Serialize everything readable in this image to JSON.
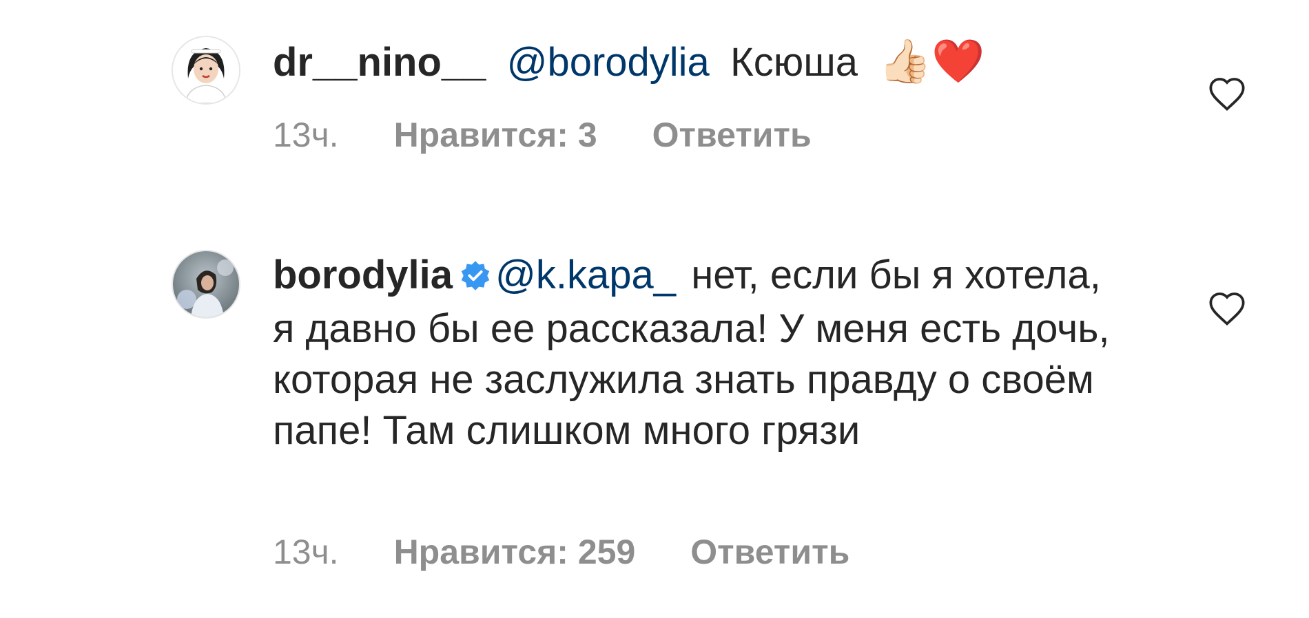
{
  "comments": [
    {
      "username": "dr__nino__",
      "verified": false,
      "mention": "@borodylia",
      "text": "Ксюша",
      "emoji": "👍🏻❤️",
      "time": "13ч.",
      "likes": "Нравится: 3",
      "reply": "Ответить"
    },
    {
      "username": "borodylia",
      "verified": true,
      "mention": "@k.kapa_",
      "text": "нет, если бы я хотела, я давно бы ее рассказала! У меня есть дочь, которая не заслужила знать правду о своём папе! Там слишком много грязи",
      "time": "13ч.",
      "likes": "Нравится: 259",
      "reply": "Ответить"
    }
  ],
  "colors": {
    "text": "#262626",
    "mention": "#00376b",
    "meta": "#8e8e8e",
    "verified": "#3897f0",
    "heart_outline": "#262626",
    "emoji_heart": "#e0141e"
  },
  "icons": {
    "like": "heart-outline-icon",
    "verified": "verified-badge-icon"
  }
}
